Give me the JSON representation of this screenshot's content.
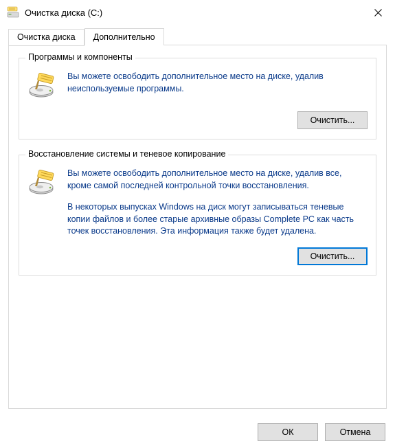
{
  "window": {
    "title": "Очистка диска  (C:)"
  },
  "tabs": {
    "cleanup": "Очистка диска",
    "more": "Дополнительно"
  },
  "programs": {
    "legend": "Программы и компоненты",
    "text": "Вы можете освободить дополнительное место на диске, удалив неиспользуемые программы.",
    "button": "Очистить..."
  },
  "restore": {
    "legend": "Восстановление системы и теневое копирование",
    "text1": "Вы можете освободить дополнительное место на диске, удалив все, кроме самой последней контрольной точки восстановления.",
    "text2": "В некоторых выпусках Windows на диск могут записываться теневые копии файлов и более старые архивные образы Complete PC как часть точек восстановления. Эта информация также будет удалена.",
    "button": "Очистить..."
  },
  "footer": {
    "ok": "ОК",
    "cancel": "Отмена"
  },
  "icons": {
    "title": "disk-cleanup-icon",
    "close": "close-icon",
    "drive": "drive-broom-icon"
  }
}
